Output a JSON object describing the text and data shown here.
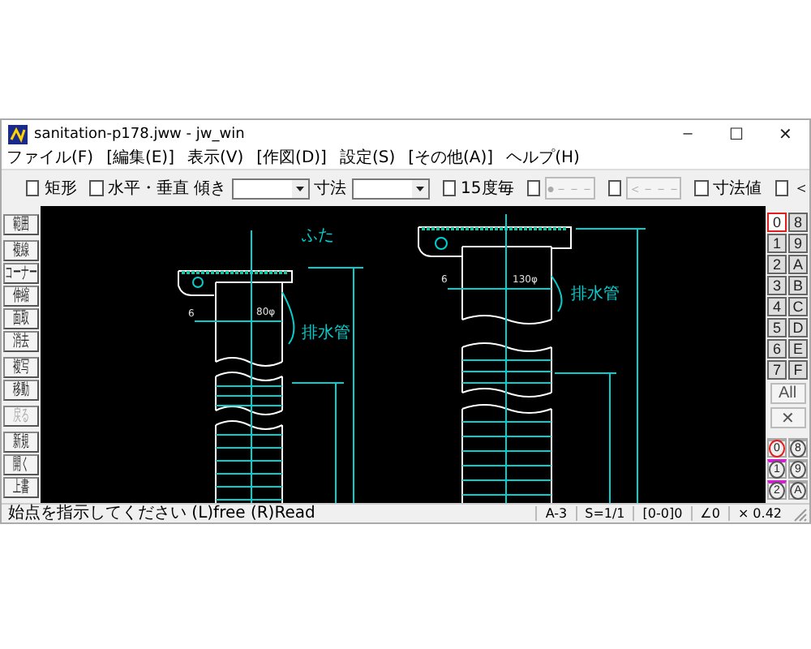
{
  "window": {
    "title": "sanitation-p178.jww - jw_win",
    "controls": [
      "–",
      "☐",
      "✕"
    ]
  },
  "menu": [
    "ファイル(F)",
    "[編集(E)]",
    "表示(V)",
    "[作図(D)]",
    "設定(S)",
    "[その他(A)]",
    "ヘルプ(H)"
  ],
  "toolbar": [
    {
      "kind": "checkbox",
      "label": "矩形",
      "checked": false
    },
    {
      "kind": "checkbox",
      "label": "水平・垂直",
      "checked": false
    },
    {
      "kind": "combo",
      "label": "傾き"
    },
    {
      "kind": "combo",
      "label": "寸法"
    },
    {
      "kind": "checkbox",
      "label": "15度毎",
      "checked": false
    },
    {
      "kind": "checkbutton",
      "label": "●－－－",
      "checked": false,
      "disabled": true
    },
    {
      "kind": "checkbutton",
      "label": "＜－－－",
      "checked": false,
      "disabled": true
    },
    {
      "kind": "checkbox",
      "label": "寸法値",
      "checked": false
    },
    {
      "kind": "checkbox",
      "label": "＜",
      "checked": false
    }
  ],
  "tool_groups": [
    [
      {
        "label": "範囲",
        "disabled": false
      }
    ],
    [
      {
        "label": "複線",
        "disabled": false
      },
      {
        "label": "コーナー",
        "disabled": false
      },
      {
        "label": "伸縮",
        "disabled": false
      },
      {
        "label": "面取",
        "disabled": false
      },
      {
        "label": "消去",
        "disabled": false
      }
    ],
    [
      {
        "label": "複写",
        "disabled": false
      },
      {
        "label": "移動",
        "disabled": false
      }
    ],
    [
      {
        "label": "戻る",
        "disabled": true
      }
    ],
    [
      {
        "label": "新規",
        "disabled": false
      },
      {
        "label": "開く",
        "disabled": false
      },
      {
        "label": "上書",
        "disabled": false
      }
    ]
  ],
  "drawing_labels": [
    "ふた",
    "6",
    "80φ",
    "排水管",
    "6",
    "130φ",
    "排水管"
  ],
  "layers": [
    {
      "label": "0",
      "selected": true
    },
    {
      "label": "8",
      "selected": false
    },
    {
      "label": "1",
      "selected": false
    },
    {
      "label": "9",
      "selected": false
    },
    {
      "label": "2",
      "selected": false
    },
    {
      "label": "A",
      "selected": false
    },
    {
      "label": "3",
      "selected": false
    },
    {
      "label": "B",
      "selected": false
    },
    {
      "label": "4",
      "selected": false
    },
    {
      "label": "C",
      "selected": false
    },
    {
      "label": "5",
      "selected": false
    },
    {
      "label": "D",
      "selected": false
    },
    {
      "label": "6",
      "selected": false
    },
    {
      "label": "E",
      "selected": false
    },
    {
      "label": "7",
      "selected": false
    },
    {
      "label": "F",
      "selected": false
    }
  ],
  "layer_actions": [
    "All",
    "✕"
  ],
  "groups": [
    {
      "label": "0",
      "selected": true,
      "marked": false
    },
    {
      "label": "8",
      "selected": false,
      "marked": false
    },
    {
      "label": "1",
      "selected": false,
      "marked": true
    },
    {
      "label": "9",
      "selected": false,
      "marked": false
    },
    {
      "label": "2",
      "selected": false,
      "marked": true
    },
    {
      "label": "A",
      "selected": false,
      "marked": false
    }
  ],
  "status_bar": {
    "message": "始点を指示してください (L)free (R)Read",
    "fields": [
      "A-3",
      "S=1/1",
      "[0-0]0",
      "∠0",
      "× 0.42"
    ]
  }
}
